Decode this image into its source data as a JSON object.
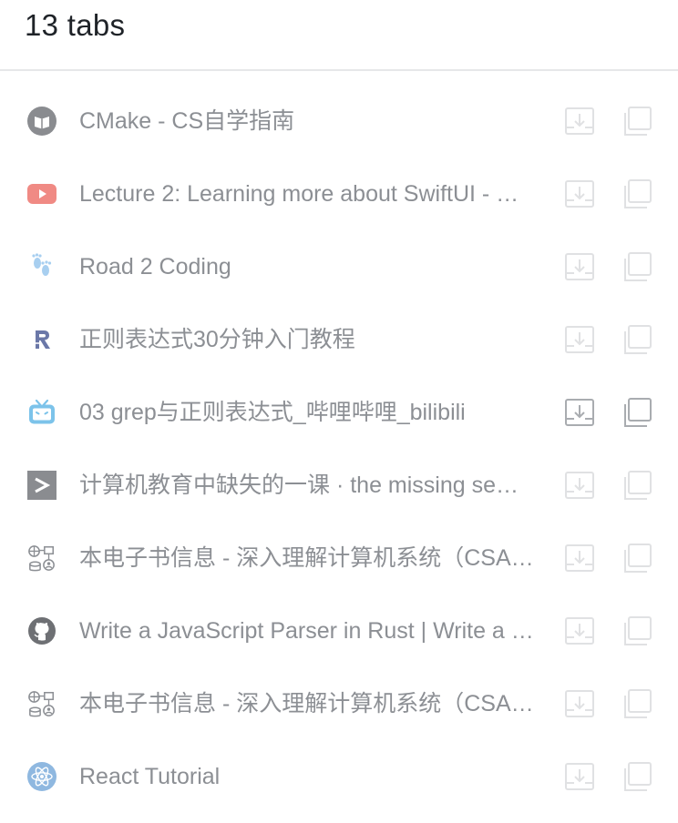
{
  "header": {
    "title": "13 tabs"
  },
  "tabs": [
    {
      "title": "CMake - CS自学指南",
      "favicon": "book-icon",
      "color": "#7d7f83",
      "highlighted": false
    },
    {
      "title": "Lecture 2: Learning more about SwiftUI - …",
      "favicon": "youtube-icon",
      "color": "#f08080",
      "highlighted": false
    },
    {
      "title": "Road 2 Coding",
      "favicon": "footprints-icon",
      "color": "#9ec9ee",
      "highlighted": false
    },
    {
      "title": "正则表达式30分钟入门教程",
      "favicon": "letter-r-icon",
      "color": "#6b78a8",
      "highlighted": false
    },
    {
      "title": "03 grep与正则表达式_哔哩哔哩_bilibili",
      "favicon": "bilibili-icon",
      "color": "#7cc3ea",
      "highlighted": true
    },
    {
      "title": "计算机教育中缺失的一课 · the missing se…",
      "favicon": "terminal-icon",
      "color": "#8a8c90",
      "highlighted": false
    },
    {
      "title": "本电子书信息 - 深入理解计算机系统（CSA…",
      "favicon": "network-diagram-icon",
      "color": "#8c8f94",
      "highlighted": false
    },
    {
      "title": "Write a JavaScript Parser in Rust | Write a …",
      "favicon": "github-icon",
      "color": "#6e7074",
      "highlighted": false
    },
    {
      "title": "本电子书信息 - 深入理解计算机系统（CSA…",
      "favicon": "network-diagram-icon",
      "color": "#8c8f94",
      "highlighted": false
    },
    {
      "title": "React Tutorial",
      "favicon": "react-icon",
      "color": "#8fb8e0",
      "highlighted": false
    }
  ]
}
